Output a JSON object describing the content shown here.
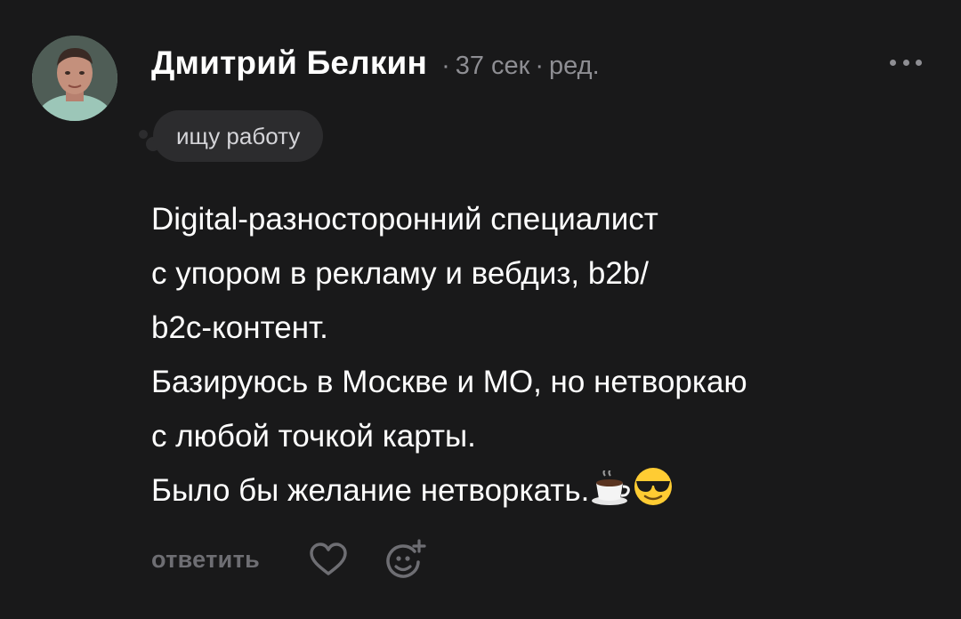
{
  "author": {
    "name": "Дмитрий Белкин",
    "time": "37 сек",
    "separator": "·",
    "edited": "ред.",
    "avatar_icon": "user-avatar-photo"
  },
  "status": {
    "text": "ищу работу"
  },
  "menu": {
    "icon": "more-horizontal-icon"
  },
  "post": {
    "lines": [
      "Digital-разносторонний специалист",
      "с упором в рекламу и вебдиз, b2b/",
      "b2c-контент.",
      "Базируюсь в Москве и МО, но нетворкаю",
      "с любой точкой карты.",
      "Было бы желание нетворкать."
    ],
    "trailing_emojis": [
      "coffee-cup-emoji",
      "sunglasses-face-emoji"
    ]
  },
  "actions": {
    "reply_label": "ответить",
    "like_icon": "heart-icon",
    "react_icon": "add-reaction-icon"
  },
  "colors": {
    "background": "#19191a",
    "text_primary": "#ffffff",
    "text_secondary": "#8e8e93",
    "badge_bg": "#2c2c2e",
    "action_gray": "#6e6e73"
  }
}
